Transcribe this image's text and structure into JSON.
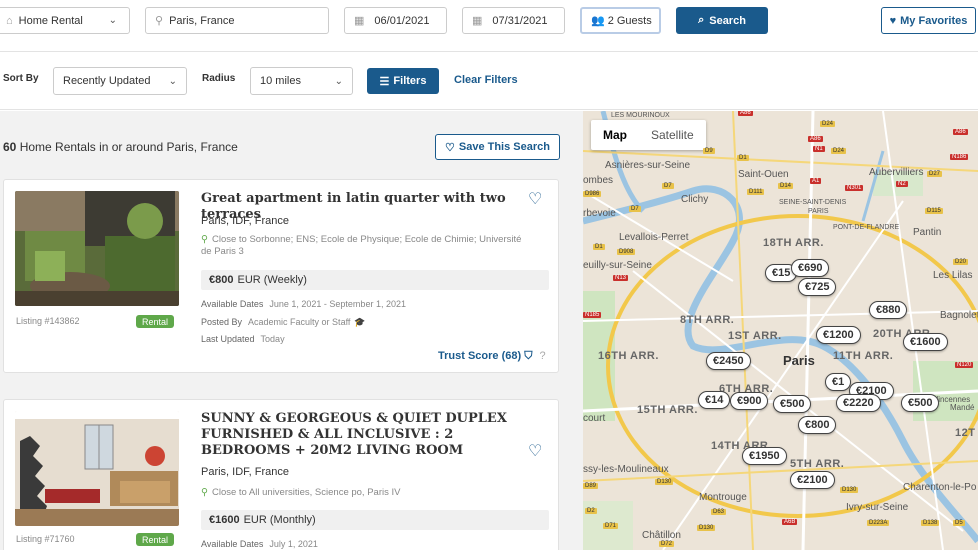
{
  "search": {
    "type_value": "Home Rental",
    "location_value": "Paris, France",
    "start_date": "06/01/2021",
    "end_date": "07/31/2021",
    "guests": "2 Guests",
    "search_label": "Search",
    "favorites_label": "My Favorites"
  },
  "filters": {
    "sort_label": "Sort By",
    "sort_value": "Recently Updated",
    "radius_label": "Radius",
    "radius_value": "10 miles",
    "filters_label": "Filters",
    "clear_label": "Clear Filters"
  },
  "results": {
    "count": "60",
    "count_text": "Home Rentals in or around Paris, France",
    "save_label": "Save This Search"
  },
  "listings": [
    {
      "title": "Great apartment in latin quarter with two terraces",
      "location": "Paris, IDF, France",
      "near": "Close to Sorbonne; ENS; Ecole de Physique; Ecole de Chimie; Université de Paris 3",
      "price": "€800",
      "price_unit": "EUR (Weekly)",
      "dates_label": "Available Dates",
      "dates": "June 1, 2021 - September 1, 2021",
      "posted_label": "Posted By",
      "posted": "Academic Faculty or Staff",
      "updated_label": "Last Updated",
      "updated": "Today",
      "id": "Listing #143862",
      "badge": "Rental",
      "trust": "Trust Score (68)"
    },
    {
      "title": "SUNNY & GEORGEOUS & QUIET DUPLEX FURNISHED & ALL INCLUSIVE : 2 BEDROOMS + 20M2 LIVING ROOM",
      "location": "Paris, IDF, France",
      "near": "Close to All universities, Science po, Paris IV",
      "price": "€1600",
      "price_unit": "EUR (Monthly)",
      "dates_label": "Available Dates",
      "dates": "July 1, 2021",
      "id": "Listing #71760",
      "badge": "Rental"
    }
  ],
  "map": {
    "map_label": "Map",
    "satellite_label": "Satellite",
    "city": "Paris",
    "labels": [
      "LES MOURINOUX",
      "Asnières-sur-Seine",
      "Saint-Ouen",
      "Aubervilliers",
      "Clichy",
      "SEINE-SAINT-DENIS",
      "PARIS",
      "PONT-DE-FLANDRE",
      "Pantin",
      "Levallois-Perret",
      "18TH ARR.",
      "euilly-sur-Seine",
      "Les Lilas",
      "8TH ARR.",
      "1ST ARR.",
      "20TH ARR.",
      "16TH ARR.",
      "11TH ARR.",
      "Bagnolet",
      "6TH ARR.",
      "15TH ARR.",
      "court",
      "14TH ARR.",
      "12T",
      "5TH ARR.",
      "ssy-les-Moulineaux",
      "Montrouge",
      "Charenton-le-Po",
      "Ivry-sur-Seine",
      "Châtillon",
      "rbevoie",
      "ombes",
      "Vincennes",
      "Mandé"
    ],
    "prices": [
      "€15",
      "€690",
      "€725",
      "€880",
      "€1200",
      "€1600",
      "€2450",
      "€1",
      "€2100",
      "€14",
      "€900",
      "€2220",
      "€500",
      "€800",
      "€1950",
      "€2100",
      "€500"
    ]
  }
}
